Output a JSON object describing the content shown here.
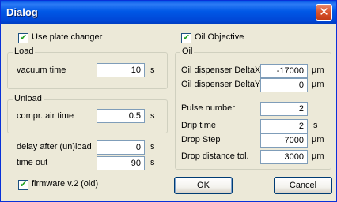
{
  "window": {
    "title": "Dialog",
    "close_glyph": "✕"
  },
  "left": {
    "use_plate_changer": {
      "label": "Use plate changer",
      "checked": true
    },
    "load": {
      "title": "Load",
      "vacuum_time": {
        "label": "vacuum time",
        "value": "10",
        "unit": "s"
      }
    },
    "unload": {
      "title": "Unload",
      "compr_air_time": {
        "label": "compr. air time",
        "value": "0.5",
        "unit": "s"
      }
    },
    "delay_after_unload": {
      "label": "delay after (un)load",
      "value": "0",
      "unit": "s"
    },
    "time_out": {
      "label": "time out",
      "value": "90",
      "unit": "s"
    },
    "firmware": {
      "label": "firmware v.2 (old)",
      "checked": true
    }
  },
  "right": {
    "oil_objective": {
      "label": "Oil Objective",
      "checked": true
    },
    "oil": {
      "title": "Oil",
      "dispenser_deltax": {
        "label": "Oil dispenser DeltaX",
        "value": "-17000",
        "unit": "µm"
      },
      "dispenser_deltay": {
        "label": "Oil dispenser DeltaY",
        "value": "0",
        "unit": "µm"
      },
      "pulse_number": {
        "label": "Pulse number",
        "value": "2"
      },
      "drip_time": {
        "label": "Drip time",
        "value": "2",
        "unit": "s"
      },
      "drop_step": {
        "label": "Drop Step",
        "value": "7000",
        "unit": "µm"
      },
      "drop_distance_tol": {
        "label": "Drop distance tol.",
        "value": "3000",
        "unit": "µm"
      }
    }
  },
  "buttons": {
    "ok": "OK",
    "cancel": "Cancel"
  },
  "check_glyph": "✔"
}
